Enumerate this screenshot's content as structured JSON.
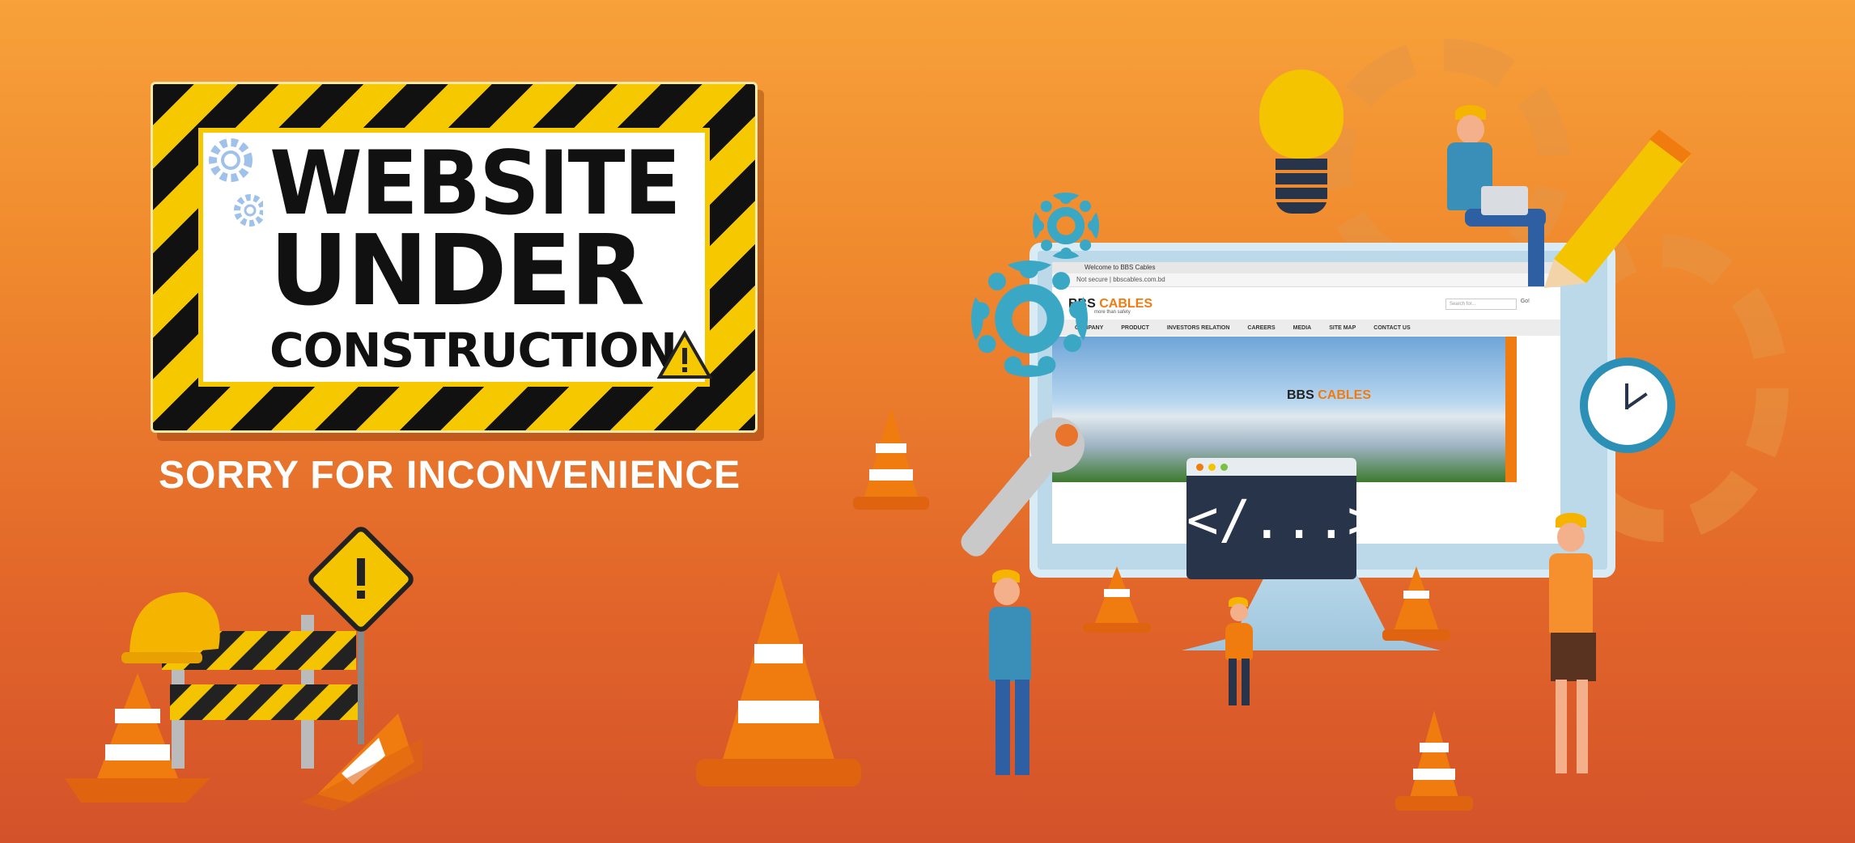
{
  "sign": {
    "line1": "WEBSITE",
    "line2": "UNDER",
    "line3": "CONSTRUCTION"
  },
  "subtitle": "SORRY FOR INCONVENIENCE",
  "screen": {
    "tab_title": "Welcome to BBS Cables",
    "url_security": "Not secure",
    "url": "bbscables.com.bd",
    "logo_bbs": "BBS",
    "logo_cables": "CABLES",
    "tagline": "more than safety",
    "search_placeholder": "Search for...",
    "go_label": "Go!",
    "nav": [
      "COMPANY",
      "PRODUCT",
      "INVESTORS RELATION",
      "CAREERS",
      "MEDIA",
      "SITE MAP",
      "CONTACT US"
    ]
  },
  "code_window": {
    "code": "</...>"
  },
  "colors": {
    "background_top": "#f7a13a",
    "background_bottom": "#d4522a",
    "sign_yellow": "#f5c800",
    "accent_blue": "#3aa8c4",
    "cone_orange": "#f07c10"
  }
}
